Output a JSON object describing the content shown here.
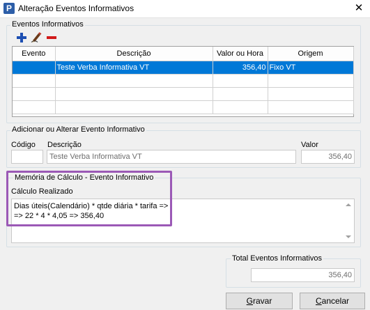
{
  "window": {
    "title": "Alteração Eventos Informativos",
    "app_icon_letter": "P",
    "close_glyph": "✕"
  },
  "eventos_group": {
    "legend": "Eventos Informativos",
    "toolbar": {
      "add_icon": "plus-icon",
      "edit_icon": "pencil-icon",
      "remove_icon": "minus-icon",
      "add_color": "#1d4fb2",
      "remove_color": "#d11a1a"
    },
    "columns": [
      "Evento",
      "Descrição",
      "Valor ou Hora",
      "Origem"
    ],
    "rows": [
      {
        "evento": "",
        "descricao": "Teste Verba Informativa VT",
        "valor": "356,40",
        "origem": "Fixo VT",
        "selected": true
      },
      {
        "evento": "",
        "descricao": "",
        "valor": "",
        "origem": "",
        "selected": false
      },
      {
        "evento": "",
        "descricao": "",
        "valor": "",
        "origem": "",
        "selected": false
      },
      {
        "evento": "",
        "descricao": "",
        "valor": "",
        "origem": "",
        "selected": false
      }
    ],
    "selection_color": "#0078d7"
  },
  "add_group": {
    "legend": "Adicionar ou Alterar Evento Informativo",
    "codigo_label": "Código",
    "codigo_value": "",
    "descricao_label": "Descrição",
    "descricao_value": "Teste Verba Informativa VT",
    "valor_label": "Valor",
    "valor_value": "356,40"
  },
  "memoria_group": {
    "legend": "Memória de Cálculo - Evento Informativo",
    "calc_label": "Cálculo Realizado",
    "lines": [
      "Dias úteis(Calendário) * qtde diária * tarifa =>",
      "=> 22 * 4 * 4,05 => 356,40"
    ],
    "highlight_color": "#9b59b6"
  },
  "total_group": {
    "legend": "Total Eventos Informativos",
    "value": "356,40"
  },
  "buttons": {
    "gravar_first": "G",
    "gravar_rest": "ravar",
    "cancelar_first": "C",
    "cancelar_rest": "ancelar"
  }
}
